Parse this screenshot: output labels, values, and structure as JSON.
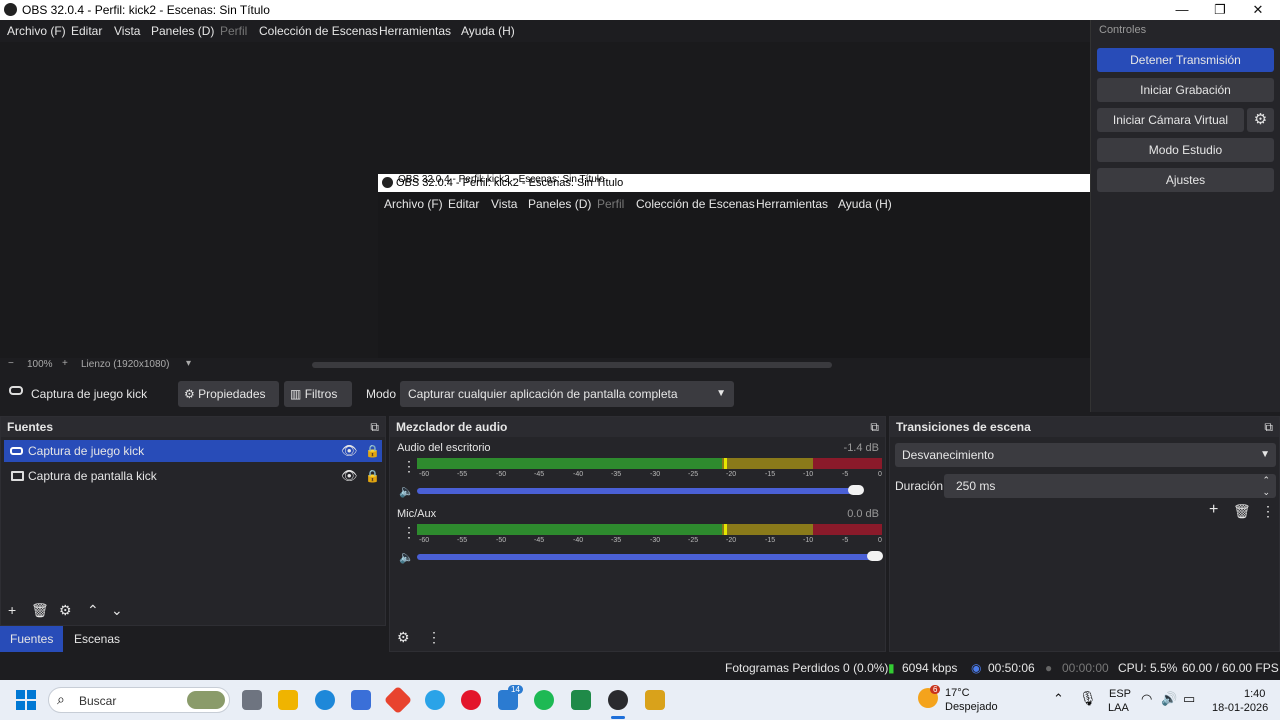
{
  "window": {
    "title": "OBS 32.0.4 - Perfil: kick2 - Escenas: Sin Título",
    "minimize": "—",
    "maximize": "❐",
    "close": "✕"
  },
  "menu": {
    "items": [
      "Archivo (F)",
      "Editar",
      "Vista",
      "Paneles (D)",
      "Perfil",
      "Colección de Escenas",
      "Herramientas",
      "Ayuda (H)"
    ]
  },
  "nested_window": {
    "title": "OBS 32.0.4 - Perfil: kick2 - Escenas: Sin Título",
    "title2": "OBS 32.0.4 - Perfil: kick2 - Escenas: Sin Título"
  },
  "zoom": {
    "minus": "−",
    "percent": "100%",
    "plus": "+",
    "canvas": "Lienzo (1920x1080)",
    "dropdown": "▾"
  },
  "controls": {
    "header": "Controles",
    "stop_stream": "Detener Transmisión",
    "start_record": "Iniciar Grabación",
    "start_vcam": "Iniciar Cámara Virtual",
    "studio_mode": "Modo Estudio",
    "settings": "Ajustes",
    "gear": "⚙"
  },
  "source_bar": {
    "source_name": "Captura de juego kick",
    "properties": "Propiedades",
    "filters": "Filtros",
    "mode_label": "Modo",
    "mode_value": "Capturar cualquier aplicación de pantalla completa"
  },
  "sources": {
    "header": "Fuentes",
    "items": [
      {
        "label": "Captura de juego kick"
      },
      {
        "label": "Captura de pantalla kick"
      }
    ]
  },
  "mixer": {
    "header": "Mezclador de audio",
    "channels": [
      {
        "name": "Audio del escritorio",
        "db": "-1.4 dB",
        "volume_level": 0.96
      },
      {
        "name": "Mic/Aux",
        "db": "0.0 dB",
        "volume_level": 1.0
      }
    ],
    "ticks": [
      "-60",
      "-55",
      "-50",
      "-45",
      "-40",
      "-35",
      "-30",
      "-25",
      "-20",
      "-15",
      "-10",
      "-5",
      "0"
    ]
  },
  "transitions": {
    "header": "Transiciones de escena",
    "type": "Desvanecimiento",
    "duration_label": "Duración",
    "duration_value": "250 ms"
  },
  "tabs": {
    "sources": "Fuentes",
    "scenes": "Escenas"
  },
  "status": {
    "dropped_frames": "Fotogramas Perdidos 0 (0.0%)",
    "bitrate": "6094 kbps",
    "stream_time": "00:50:06",
    "record_time": "00:00:00",
    "cpu": "CPU: 5.5%",
    "fps": "60.00 / 60.00 FPS"
  },
  "taskbar": {
    "search_placeholder": "Buscar",
    "weather_temp": "17°C",
    "weather_desc": "Despejado",
    "weather_badge": "6",
    "store_badge": "14",
    "lang1": "ESP",
    "lang2": "LAA",
    "time": "1:40",
    "date": "18-01-2026"
  },
  "colors": {
    "accent": "#284cb8",
    "meter_green": "#2e8b2e",
    "meter_yellow": "#8a7a1a",
    "meter_red": "#8a1a2a",
    "slider": "#4a60d6"
  }
}
